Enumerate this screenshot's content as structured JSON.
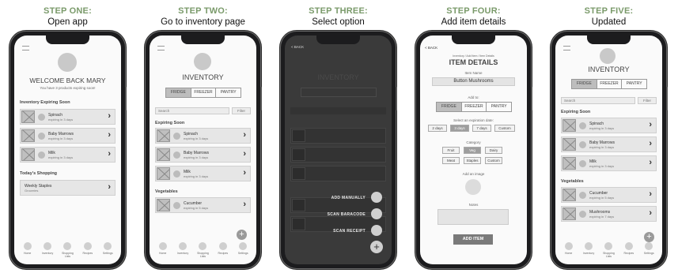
{
  "steps": [
    {
      "title": "STEP ONE:",
      "subtitle": "Open app"
    },
    {
      "title": "STEP TWO:",
      "subtitle": "Go to inventory page"
    },
    {
      "title": "STEP THREE:",
      "subtitle": "Select option"
    },
    {
      "title": "STEP FOUR:",
      "subtitle": "Add item details"
    },
    {
      "title": "STEP FIVE:",
      "subtitle": "Updated"
    }
  ],
  "home": {
    "welcome": "WELCOME BACK MARY",
    "subline": "You have 3 products expiring soon!",
    "section_expiring": "Inventory Expiring Soon",
    "items": [
      {
        "name": "Spinach",
        "sub": "expiring in 3 days"
      },
      {
        "name": "Baby Marrows",
        "sub": "expiring in 3 days"
      },
      {
        "name": "Milk",
        "sub": "expiring in 3 days"
      }
    ],
    "section_shopping": "Today's Shopping",
    "shopping_item": {
      "name": "Weekly Staples",
      "sub": "Groceries"
    }
  },
  "inventory": {
    "title": "INVENTORY",
    "tabs": [
      "FRIDGE",
      "FREEZER",
      "PANTRY"
    ],
    "search_placeholder": "Search",
    "filter": "Filter",
    "expiring_title": "Expiring Soon",
    "expiring": [
      {
        "name": "Spinach",
        "sub": "expiring in 3 days"
      },
      {
        "name": "Baby Marrows",
        "sub": "expiring in 3 days"
      },
      {
        "name": "Milk",
        "sub": "expiring in 3 days"
      }
    ],
    "veg_title": "Vegetables",
    "veg": [
      {
        "name": "Cucumber",
        "sub": "expiring in 5 days"
      }
    ],
    "fab": "+"
  },
  "select": {
    "back": "< BACK",
    "title": "INVENTORY",
    "options": [
      "ADD MANUALLY",
      "SCAN BARACODE",
      "SCAN RECEIPT"
    ],
    "fab": "+"
  },
  "details": {
    "back": "< BACK",
    "breadcrumb": "Inventory / Add Item / Item Details",
    "title": "ITEM DETAILS",
    "item_name_label": "Item Name",
    "item_name": "Button Mushrooms",
    "add_to_label": "Add to:",
    "add_to": [
      "FRIDGE",
      "FREEZER",
      "PANTRY"
    ],
    "expiration_label": "Select an expiration date:",
    "expiration": [
      "2 days",
      "3 days",
      "7 days",
      "Custom"
    ],
    "category_label": "Category",
    "categories": [
      "Fruit",
      "Veg",
      "Dairy",
      "Meat",
      "Staples",
      "Custom"
    ],
    "image_label": "Add an image",
    "notes_label": "Notes",
    "add_button": "ADD ITEM"
  },
  "updated": {
    "title": "INVENTORY",
    "tabs": [
      "FRIDGE",
      "FREEZER",
      "PANTRY"
    ],
    "search_placeholder": "Search",
    "filter": "Filter",
    "expiring_title": "Expiring Soon",
    "expiring": [
      {
        "name": "Spinach",
        "sub": "expiring in 3 days"
      },
      {
        "name": "Baby Marrows",
        "sub": "expiring in 3 days"
      },
      {
        "name": "Milk",
        "sub": "expiring in 3 days"
      }
    ],
    "veg_title": "Vegetables",
    "veg": [
      {
        "name": "Cucumber",
        "sub": "expiring in 5 days"
      },
      {
        "name": "Mushrooms",
        "sub": "expiring in 7 days"
      }
    ],
    "fab": "+"
  },
  "nav": [
    "Home",
    "Inventory",
    "Shopping Lists",
    "Recipes",
    "Settings"
  ]
}
